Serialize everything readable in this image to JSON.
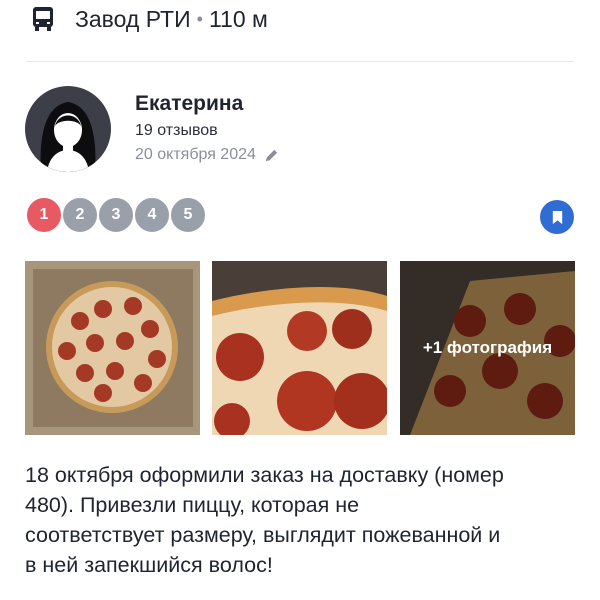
{
  "transit": {
    "icon": "bus-icon",
    "stop_name": "Завод РТИ",
    "separator": "•",
    "distance": "110 м"
  },
  "review": {
    "author": {
      "name": "Екатерина",
      "reviews_count": "19 отзывов",
      "avatar_icon": "avatar-silhouette-icon"
    },
    "date": "20 октября 2024",
    "edited_icon": "pencil-icon",
    "rating": {
      "value": 1,
      "max": 5,
      "labels": [
        "1",
        "2",
        "3",
        "4",
        "5"
      ],
      "active_color": "#e85a63",
      "inactive_color": "#9aa0aa"
    },
    "bookmark_icon": "bookmark-icon",
    "bookmark_color": "#2f6cd4",
    "photos": [
      {
        "name": "pizza-photo-whole"
      },
      {
        "name": "pizza-photo-closeup"
      },
      {
        "name": "pizza-photo-extra"
      }
    ],
    "more_photos_label": "+1 фотография",
    "text_lines": [
      "18 октября оформили заказ на доставку (номер",
      "480). Привезли пиццу, которая не",
      "соответствует размеру, выглядит пожеванной и",
      "в ней запекшийся волос!"
    ]
  }
}
